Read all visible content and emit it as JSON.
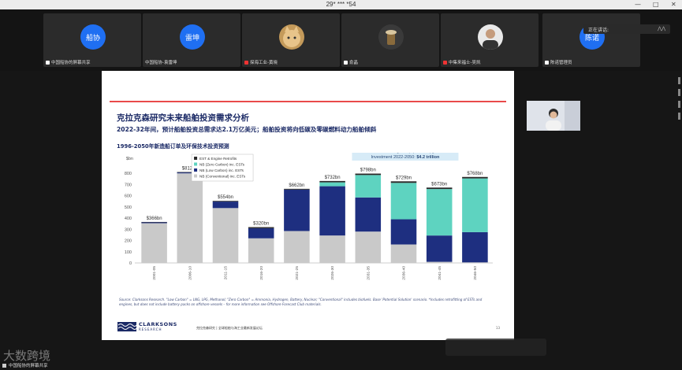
{
  "window": {
    "title": "29* *** *54",
    "controls": [
      "—",
      "□",
      "✕"
    ]
  },
  "participants": [
    {
      "name": "中国船协的屏幕共享",
      "avatar_text": "船协",
      "type": "blue",
      "mic": "on"
    },
    {
      "name": "中国船协-袁雷坤",
      "avatar_text": "雷坤",
      "type": "blue",
      "mic": "on"
    },
    {
      "name": "探海工业-黄晓",
      "avatar_text": "",
      "type": "photo-cat",
      "mic": "muted"
    },
    {
      "name": "俞晶",
      "avatar_text": "",
      "type": "photo-drink",
      "mic": "on"
    },
    {
      "name": "中集来福士-吴凯",
      "avatar_text": "",
      "type": "photo-man",
      "mic": "muted"
    },
    {
      "name": "陈诺管理员",
      "avatar_text": "陈诺",
      "type": "blue",
      "mic": "on"
    }
  ],
  "speaking_label": "正在讲话:",
  "slide": {
    "title": "克拉克森研究未来船舶投资需求分析",
    "subtitle": "2022-32年间，预计船舶投资总需求达2.1万亿美元；船舶投资将向低碳及零碳燃料动力船舶倾斜",
    "chart_heading": "1996-2050年新造船订单及环保技术投资预测",
    "source_note": "Source: Clarksons Research. \"Low Carbon\" = LNG, LPG, Methanol; \"Zero Carbon\" = Ammonia, Hydrogen, Battery, Nuclear; \"Conventional\" includes biofuels. Base 'Potential Solution' scenario. *Includes retrofitting of ESTs and engines, but does not include battery packs on offshore vessels – for more information see Offshore Forecast Club materials.",
    "logo_main": "CLARKSONS",
    "logo_sub": "RESEARCH",
    "footer_mid": "克拉克森研究 | 全球船舶与海工业最新发展论坛",
    "page_number": "13"
  },
  "chart_data": {
    "type": "bar",
    "unit_label": "$bn",
    "ylim": [
      0,
      900
    ],
    "yticks": [
      0,
      100,
      200,
      300,
      400,
      500,
      600,
      700,
      800,
      900
    ],
    "categories": [
      "2001-05",
      "2006-10",
      "2011-15",
      "2016-20",
      "2021-25",
      "2026-30",
      "2031-35",
      "2036-40",
      "2041-45",
      "2046-50"
    ],
    "totals_labels": [
      "$366bn",
      "$812bn",
      "$554bn",
      "$320bn",
      "$662bn",
      "$732bn",
      "$798bn",
      "$729bn",
      "$673bn",
      "$768bn"
    ],
    "series": [
      {
        "name": "NB (Conventional) inc. ESTs",
        "color": "#c9c9c9",
        "values": [
          355,
          800,
          490,
          220,
          285,
          245,
          280,
          165,
          10,
          5
        ]
      },
      {
        "name": "NB (Low Carbon) inc. ESTs",
        "color": "#1e2f80",
        "values": [
          8,
          8,
          58,
          90,
          370,
          440,
          305,
          225,
          235,
          270
        ]
      },
      {
        "name": "NB (Zero Carbon) inc. ESTs",
        "color": "#5ed3c0",
        "values": [
          0,
          0,
          0,
          0,
          0,
          35,
          200,
          325,
          415,
          480
        ]
      },
      {
        "name": "EST & Engine Retrofits",
        "color": "#2a2a2a",
        "values": [
          3,
          4,
          6,
          10,
          7,
          12,
          13,
          14,
          13,
          13
        ]
      }
    ],
    "legend_order": [
      "EST & Engine Retrofits",
      "NB (Zero Carbon) inc. ESTs",
      "NB (Low Carbon) inc. ESTs",
      "NB (Conventional) inc. ESTs"
    ],
    "callout": {
      "line1": "Total Newbuilding & Equipment Upgrades",
      "line2_prefix": "Investment 2022-2050: ",
      "line2_value": "$4.2 trillion"
    }
  },
  "watermark": "大数跨境",
  "share_label": "中国船协的屏幕共享"
}
